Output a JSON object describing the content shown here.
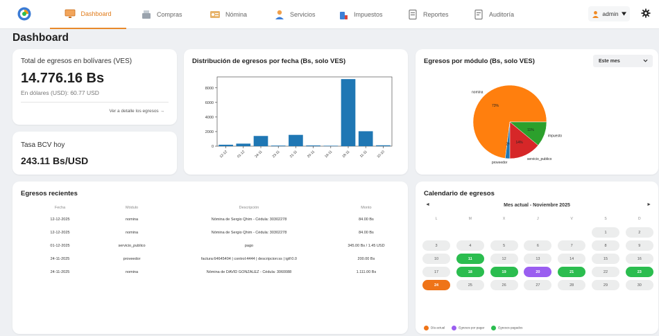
{
  "nav": {
    "items": [
      {
        "label": "Dashboard",
        "icon": "monitor-icon"
      },
      {
        "label": "Compras",
        "icon": "cash-register-icon"
      },
      {
        "label": "Nómina",
        "icon": "payroll-card-icon"
      },
      {
        "label": "Servicios",
        "icon": "service-person-icon"
      },
      {
        "label": "Impuestos",
        "icon": "tax-bottle-icon"
      },
      {
        "label": "Reportes",
        "icon": "report-icon"
      },
      {
        "label": "Auditoría",
        "icon": "audit-icon"
      }
    ],
    "active": "Dashboard",
    "user": "admin"
  },
  "page_title": "Dashboard",
  "total": {
    "title": "Total de egresos en bolívares (VES)",
    "amount": "14.776.16 Bs",
    "usd": "En dólares (USD): 60.77 USD",
    "link": "Ver a detalle los egresos →"
  },
  "tasa": {
    "title": "Tasa BCV hoy",
    "value": "243.11 Bs/USD"
  },
  "distribution": {
    "title": "Distribución de egresos por fecha (Bs, solo VES)"
  },
  "modules": {
    "title": "Egresos por módulo (Bs, solo VES)",
    "select_value": "Este mes"
  },
  "recent": {
    "title": "Egresos recientes",
    "headers": [
      "Fecha",
      "Módulo",
      "Descripción",
      "Monto"
    ],
    "rows": [
      [
        "12-12-2025",
        "nomina",
        "Nómina de Sergio Qhim - Cédula: 30302278",
        "84.00 Bs"
      ],
      [
        "12-12-2025",
        "nomina",
        "Nómina de Sergio Qhim - Cédula: 30302278",
        "84.00 Bs"
      ],
      [
        "01-12-2025",
        "servicio_publico",
        "pago",
        "345.00 Bs / 1.45 USD"
      ],
      [
        "24-11-2025",
        "proveedor",
        "factura:64645404 | control:4444 | descripcion:ss | igtf:0.0",
        "200.00 Bs"
      ],
      [
        "24-11-2025",
        "nomina",
        "Nómina de DAVID GONZALEZ - Cédula: 3060088",
        "1.111.00 Bs"
      ]
    ]
  },
  "calendar": {
    "title": "Calendario de egresos",
    "prev": "◄",
    "next": "►",
    "month_label": "Mes actual - Noviembre 2025",
    "weekdays": [
      "L",
      "M",
      "X",
      "J",
      "V",
      "S",
      "D"
    ],
    "leading_blanks": 5,
    "days_in_month": 30,
    "paid_days": [
      11,
      18,
      19,
      21,
      23
    ],
    "pending_days": [
      20
    ],
    "today": 24,
    "legend": [
      "Día actual",
      "Egresos por pagar",
      "Egresos pagados"
    ],
    "colors": {
      "today": "#ef7418",
      "pending": "#9a5ef0",
      "paid": "#2bbd4f"
    }
  },
  "chart_data": [
    {
      "type": "bar",
      "categories": [
        "12-12",
        "01-12",
        "24-11",
        "23-11",
        "21-11",
        "20-11",
        "19-11",
        "18-11",
        "11-11",
        "10-10"
      ],
      "values": [
        200,
        350,
        1400,
        80,
        1550,
        100,
        60,
        9200,
        2050,
        120
      ],
      "ylim": [
        0,
        9500
      ],
      "yticks": [
        0,
        2000,
        4000,
        6000,
        8000
      ],
      "color": "#1f77b4"
    },
    {
      "type": "pie",
      "labels": [
        "nomina",
        "proveedor",
        "servicio_publico",
        "impuesto"
      ],
      "values": [
        73,
        2,
        14,
        11
      ],
      "pct_labels": [
        "73%",
        "2%",
        "14%",
        "11%"
      ],
      "colors": [
        "#ff7f0e",
        "#1f77b4",
        "#d62728",
        "#2ca02c"
      ]
    }
  ]
}
